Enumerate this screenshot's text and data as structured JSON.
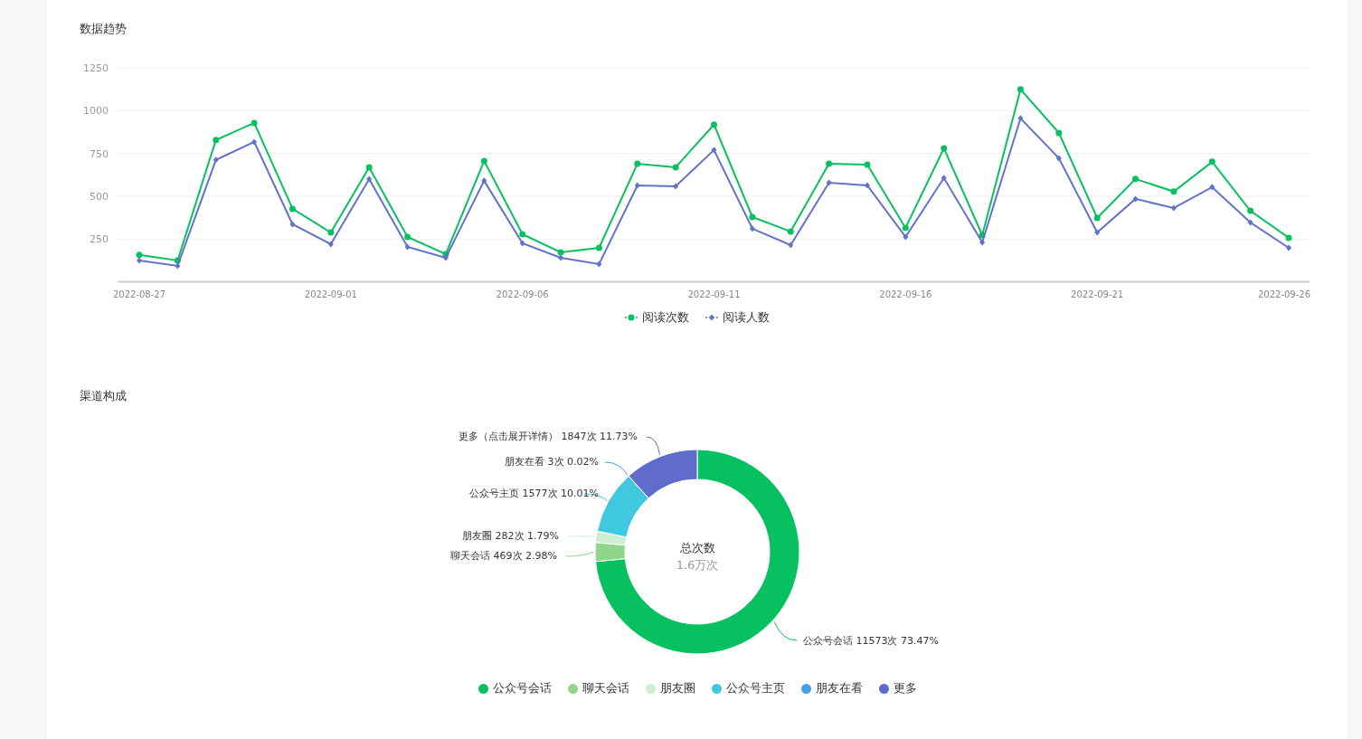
{
  "trend": {
    "title": "数据趋势",
    "chart_data": {
      "type": "line",
      "categories": [
        "2022-08-27",
        null,
        null,
        null,
        null,
        "2022-09-01",
        null,
        null,
        null,
        null,
        "2022-09-06",
        null,
        null,
        null,
        null,
        "2022-09-11",
        null,
        null,
        null,
        null,
        "2022-09-16",
        null,
        null,
        null,
        null,
        "2022-09-21",
        null,
        null,
        null,
        null,
        "2022-09-26"
      ],
      "grid": true,
      "series": [
        {
          "name": "阅读次数",
          "color": "#07c160",
          "marker": "circle",
          "values": [
            157,
            124,
            828,
            928,
            426,
            288,
            669,
            262,
            161,
            706,
            278,
            172,
            198,
            690,
            669,
            918,
            378,
            294,
            690,
            685,
            315,
            780,
            272,
            1124,
            870,
            373,
            601,
            527,
            701,
            415,
            257
          ]
        },
        {
          "name": "阅读人数",
          "color": "#6272c8",
          "marker": "diamond",
          "values": [
            124,
            93,
            712,
            817,
            336,
            220,
            600,
            204,
            140,
            590,
            225,
            140,
            103,
            563,
            558,
            770,
            310,
            214,
            579,
            563,
            262,
            606,
            230,
            955,
            722,
            288,
            484,
            431,
            553,
            346,
            198
          ]
        }
      ],
      "ylim": [
        0,
        1250
      ],
      "yticks": [
        250,
        500,
        750,
        1000,
        1250
      ]
    }
  },
  "channels": {
    "title": "渠道构成",
    "center_label": "总次数",
    "center_value": "1.6万次",
    "chart_data": {
      "type": "donut",
      "categories": [
        "公众号会话",
        "聊天会话",
        "朋友圈",
        "公众号主页",
        "朋友在看",
        "更多"
      ],
      "values": [
        11573,
        469,
        282,
        1577,
        3,
        1847
      ],
      "colors": [
        "#07c160",
        "#8fd68a",
        "#cfeed2",
        "#40c8e0",
        "#4aa0e6",
        "#5f6ccc"
      ],
      "value_labels": [
        "公众号会话 11573次 73.47%",
        "聊天会话 469次 2.98%",
        "朋友圈 282次 1.79%",
        "公众号主页 1577次 10.01%",
        "朋友在看 3次 0.02%",
        "更多（点击展开详情） 1847次 11.73%"
      ]
    }
  }
}
